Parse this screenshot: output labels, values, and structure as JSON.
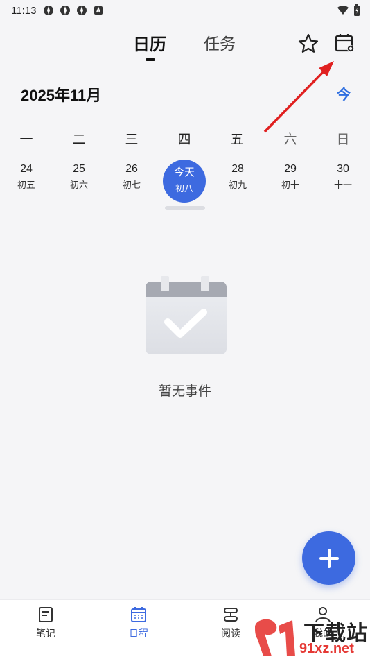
{
  "status_bar": {
    "time": "11:13"
  },
  "header": {
    "tabs": [
      {
        "label": "日历",
        "active": true
      },
      {
        "label": "任务",
        "active": false
      }
    ],
    "star_icon": "star-icon",
    "calendar_icon": "calendar-settings-icon"
  },
  "month": {
    "title": "2025年11月",
    "today_label": "今"
  },
  "weekdays": [
    "一",
    "二",
    "三",
    "四",
    "五",
    "六",
    "日"
  ],
  "days": [
    {
      "num": "24",
      "lunar": "初五"
    },
    {
      "num": "25",
      "lunar": "初六"
    },
    {
      "num": "26",
      "lunar": "初七"
    },
    {
      "num": "今天",
      "lunar": "初八",
      "today": true
    },
    {
      "num": "28",
      "lunar": "初九"
    },
    {
      "num": "29",
      "lunar": "初十"
    },
    {
      "num": "30",
      "lunar": "十一"
    }
  ],
  "empty_state": {
    "text": "暂无事件"
  },
  "fab": {
    "icon": "plus-icon"
  },
  "bottom_nav": [
    {
      "label": "笔记",
      "icon": "note-icon",
      "active": false
    },
    {
      "label": "日程",
      "icon": "calendar-icon",
      "active": true
    },
    {
      "label": "阅读",
      "icon": "read-icon",
      "active": false
    },
    {
      "label": "我的",
      "icon": "profile-icon",
      "active": false
    }
  ],
  "watermark": {
    "text": "下载站",
    "sub": "91xz.net"
  },
  "colors": {
    "accent": "#3d6ae0",
    "arrow": "#e02020",
    "background": "#f5f5f7"
  }
}
